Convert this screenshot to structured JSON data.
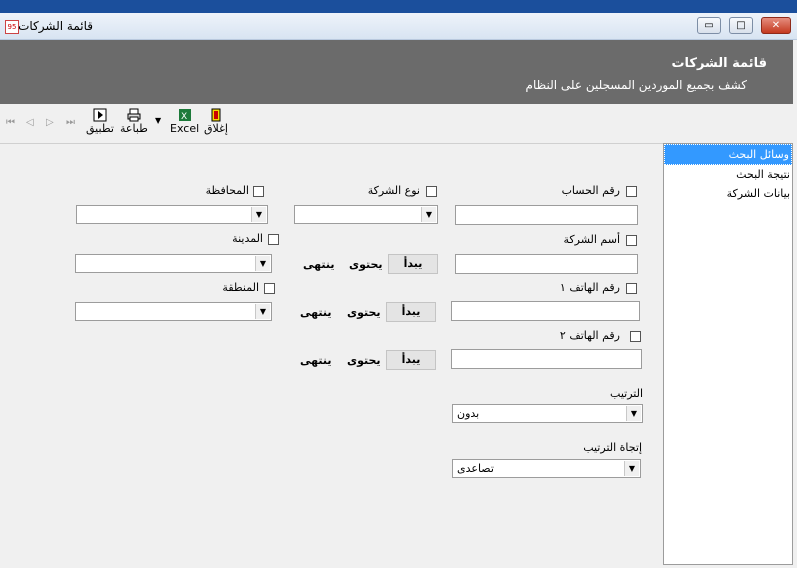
{
  "window": {
    "title": "قائمة الشركات",
    "controls": {
      "minimize": "▭",
      "maximize": "□",
      "close": "✕"
    }
  },
  "header": {
    "title": "قائمة الشركات",
    "subtitle": "كشف بجميع الموردين المسجلين على النظام"
  },
  "toolbar": {
    "close_label": "إغلاق",
    "excel_label": "Excel",
    "print_label": "طباعة",
    "apply_label": "تطبيق",
    "nav": [
      "⏮",
      "◁",
      "▷",
      "⏭"
    ]
  },
  "sidebar": {
    "items": [
      {
        "label": "وسائل البحث",
        "active": true
      },
      {
        "label": "نتيجة البحث",
        "active": false
      },
      {
        "label": "بيانات الشركة",
        "active": false
      }
    ]
  },
  "form": {
    "account_number_label": "رقم الحساب",
    "company_type_label": "نوع الشركة",
    "governorate_label": "المحافظة",
    "company_name_label": "أسم الشركة",
    "city_label": "المدينة",
    "phone1_label": "رقم الهاتف ١",
    "region_label": "المنطقة",
    "phone2_label": "رقم الهاتف ٢",
    "match_starts": "يبدأ",
    "match_contains": "يحتوى",
    "match_ends": "ينتهى",
    "sort_label": "الترتيب",
    "sort_value": "بدون",
    "sort_dir_label": "إتجاة الترتيب",
    "sort_dir_value": "تصاعدى"
  }
}
